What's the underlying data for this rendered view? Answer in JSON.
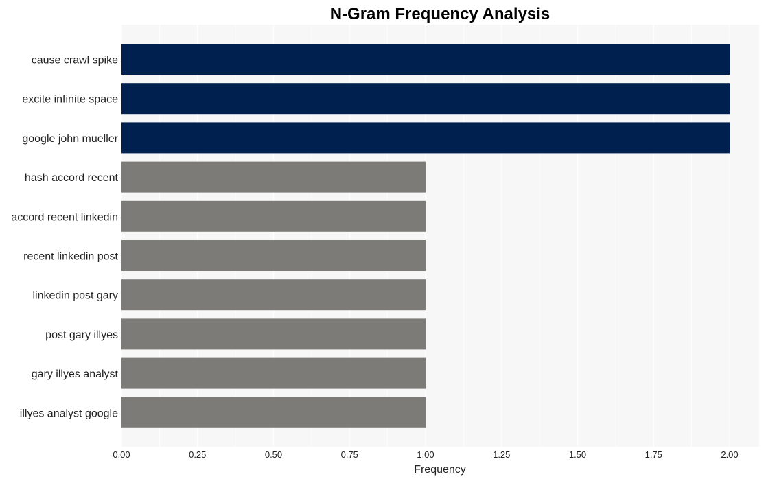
{
  "chart_data": {
    "type": "bar",
    "orientation": "horizontal",
    "title": "N-Gram Frequency Analysis",
    "xlabel": "Frequency",
    "ylabel": "",
    "xlim": [
      0,
      2.1
    ],
    "xticks": [
      "0.00",
      "0.25",
      "0.50",
      "0.75",
      "1.00",
      "1.25",
      "1.50",
      "1.75",
      "2.00"
    ],
    "grid": true,
    "categories": [
      "cause crawl spike",
      "excite infinite space",
      "google john mueller",
      "hash accord recent",
      "accord recent linkedin",
      "recent linkedin post",
      "linkedin post gary",
      "post gary illyes",
      "gary illyes analyst",
      "illyes analyst google"
    ],
    "values": [
      2,
      2,
      2,
      1,
      1,
      1,
      1,
      1,
      1,
      1
    ],
    "colors": {
      "top": "#00204f",
      "other": "#7d7b77",
      "panel_background": "#f7f7f7",
      "grid": "#ffffff"
    }
  }
}
